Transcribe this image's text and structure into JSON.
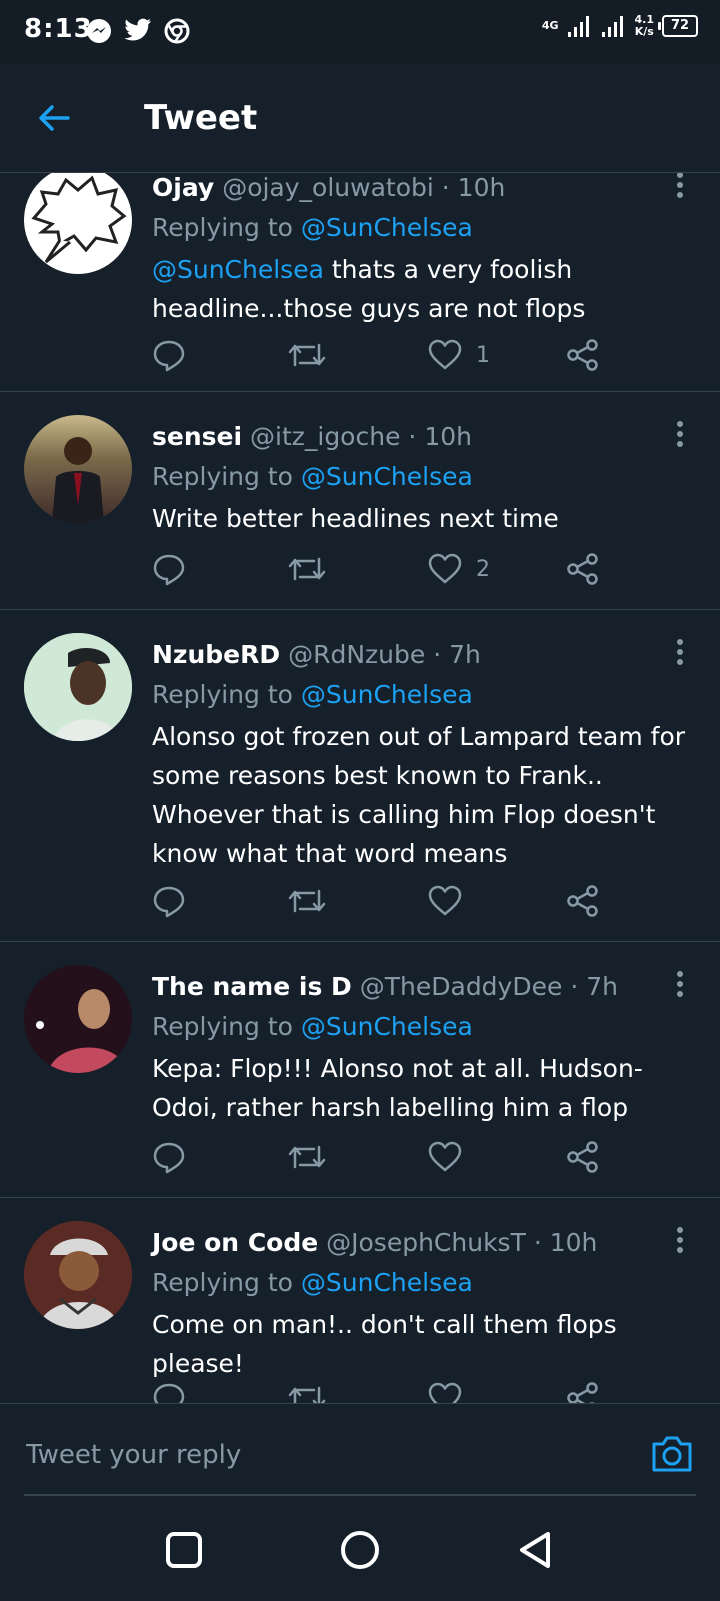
{
  "status_bar": {
    "time": "8:13",
    "network": "4G",
    "speed_value": "4.1",
    "speed_unit": "K/s",
    "battery": "72"
  },
  "header": {
    "title": "Tweet"
  },
  "tweets": [
    {
      "name": "Ojay",
      "handle": "@ojay_oluwatobi",
      "time": "10h",
      "reply_prefix": "Replying to",
      "reply_to": "@SunChelsea",
      "mention": "@SunChelsea",
      "text": "thats a very foolish headline...those guys are not flops",
      "likes": "1"
    },
    {
      "name": "sensei",
      "handle": "@itz_igoche",
      "time": "10h",
      "reply_prefix": "Replying to",
      "reply_to": "@SunChelsea",
      "text": "Write better headlines next time",
      "likes": "2"
    },
    {
      "name": "NzubeRD",
      "handle": "@RdNzube",
      "time": "7h",
      "reply_prefix": "Replying to",
      "reply_to": "@SunChelsea",
      "text": "Alonso got frozen out of Lampard team for some reasons best known to Frank.. Whoever that is calling him Flop doesn't know what that word means",
      "likes": ""
    },
    {
      "name": "The name is D",
      "handle": "@TheDaddyDee",
      "time": "7h",
      "reply_prefix": "Replying to",
      "reply_to": "@SunChelsea",
      "text": "Kepa: Flop!!! Alonso not at all. Hudson-Odoi, rather harsh labelling him a flop",
      "likes": ""
    },
    {
      "name": "Joe on Code",
      "handle": "@JosephChuksT",
      "time": "10h",
      "reply_prefix": "Replying to",
      "reply_to": "@SunChelsea",
      "text": "Come on man!.. don't call them flops please!",
      "likes": ""
    }
  ],
  "reply_bar": {
    "placeholder": "Tweet your reply"
  },
  "icons": {
    "back": "arrow-left-icon",
    "more": "more-vertical-icon",
    "reply": "comment-icon",
    "retweet": "retweet-icon",
    "like": "heart-icon",
    "share": "share-icon",
    "camera": "camera-icon"
  },
  "colors": {
    "background": "#15202b",
    "accent": "#1da1f2",
    "muted": "#8899a6",
    "divider": "#38444d"
  }
}
